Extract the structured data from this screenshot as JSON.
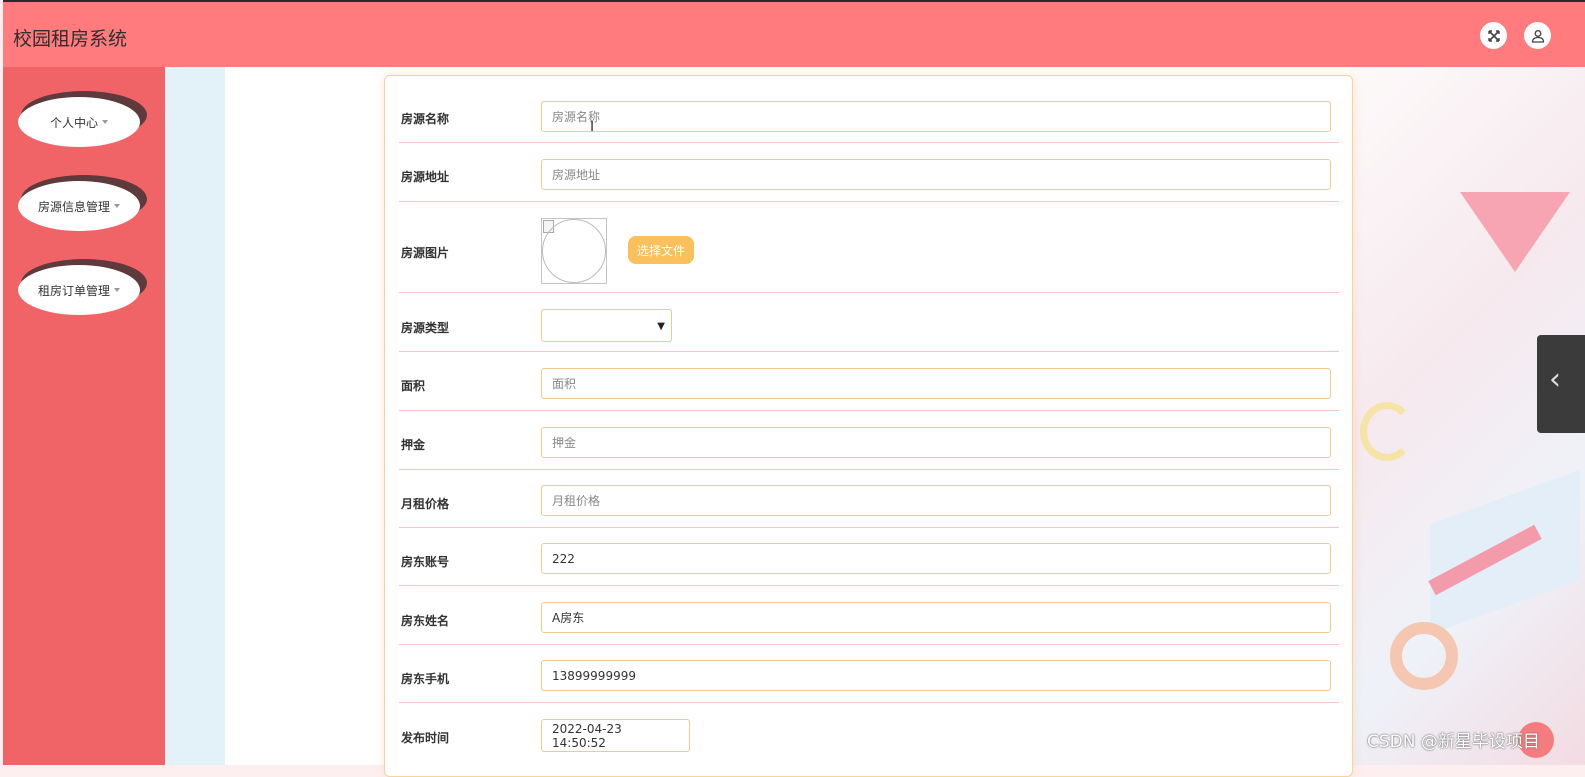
{
  "header": {
    "app_title": "校园租房系统",
    "close_icon": "close-x",
    "user_icon": "user"
  },
  "sidebar": {
    "items": [
      {
        "label": "个人中心"
      },
      {
        "label": "房源信息管理"
      },
      {
        "label": "租房订单管理"
      }
    ]
  },
  "form": {
    "house_name": {
      "label": "房源名称",
      "placeholder": "房源名称",
      "value": ""
    },
    "house_address": {
      "label": "房源地址",
      "placeholder": "房源地址",
      "value": ""
    },
    "house_image": {
      "label": "房源图片",
      "button": "选择文件"
    },
    "house_type": {
      "label": "房源类型",
      "value": ""
    },
    "area": {
      "label": "面积",
      "placeholder": "面积",
      "value": ""
    },
    "deposit": {
      "label": "押金",
      "placeholder": "押金",
      "value": ""
    },
    "monthly_rent": {
      "label": "月租价格",
      "placeholder": "月租价格",
      "value": ""
    },
    "landlord_account": {
      "label": "房东账号",
      "value": "222"
    },
    "landlord_name": {
      "label": "房东姓名",
      "value": "A房东"
    },
    "landlord_phone": {
      "label": "房东手机",
      "value": "13899999999"
    },
    "publish_time": {
      "label": "发布时间",
      "value": "2022-04-23 14:50:52"
    }
  },
  "watermark": "CSDN @新星毕设项目",
  "colors": {
    "topbar": "#ff7b7d",
    "sidebar": "#f06467",
    "input_border": "#f1c98d",
    "button": "#f9c05b"
  }
}
